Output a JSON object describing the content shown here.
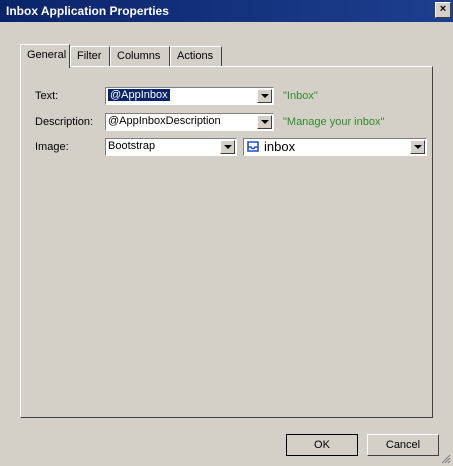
{
  "window": {
    "title": "Inbox Application Properties",
    "close_glyph": "×"
  },
  "tabs": [
    {
      "label": "General",
      "active": true
    },
    {
      "label": "Filter",
      "active": false
    },
    {
      "label": "Columns",
      "active": false
    },
    {
      "label": "Actions",
      "active": false
    }
  ],
  "form": {
    "text": {
      "label": "Text:",
      "value": "@AppInbox",
      "preview": "\"Inbox\""
    },
    "description": {
      "label": "Description:",
      "value": "@AppInboxDescription",
      "preview": "\"Manage your inbox\""
    },
    "image": {
      "label": "Image:",
      "library": "Bootstrap",
      "icon_value": "inbox",
      "icon": "inbox-icon"
    }
  },
  "buttons": {
    "ok": "OK",
    "cancel": "Cancel"
  },
  "colors": {
    "title_bar": "#0a246a",
    "preview_text": "#2e8b2e",
    "dialog_bg": "#d4d0c8"
  }
}
